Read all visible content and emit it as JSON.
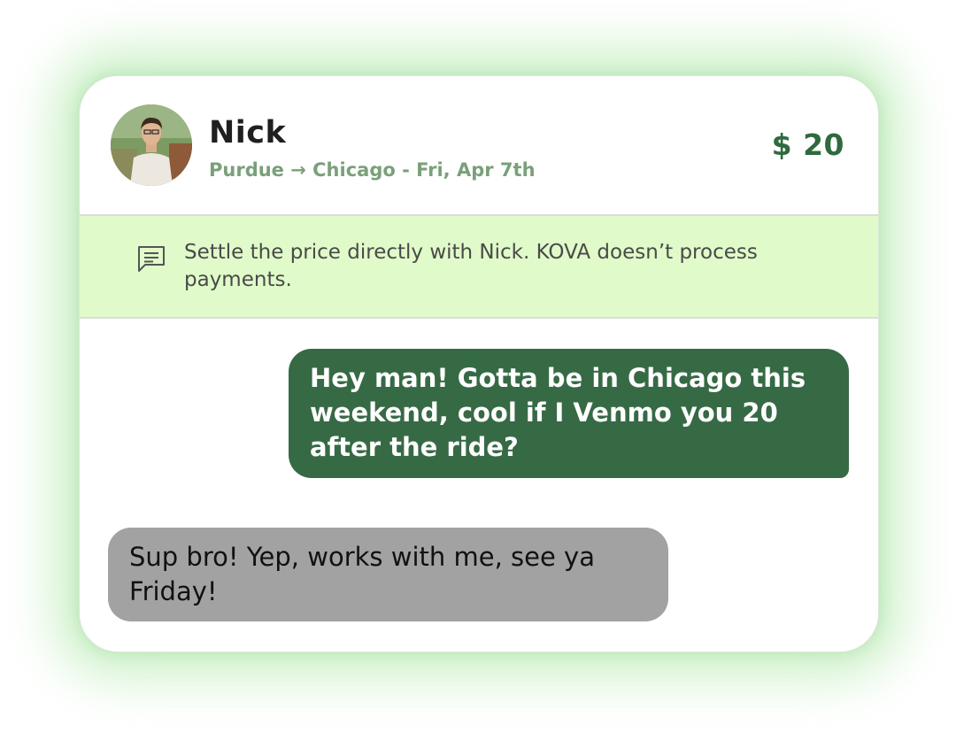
{
  "header": {
    "driver_name": "Nick",
    "route": "Purdue → Chicago - Fri, Apr 7th",
    "price": "$ 20"
  },
  "notice": {
    "icon": "message-icon",
    "text": "Settle the price directly with Nick. KOVA doesn’t process payments."
  },
  "messages": [
    {
      "sender": "me",
      "text": "Hey man! Gotta be in Chicago this weekend, cool if I Venmo you 20 after the ride?"
    },
    {
      "sender": "other",
      "text": "Sup bro! Yep, works with me, see ya Friday!"
    }
  ],
  "colors": {
    "accent_green": "#366a45",
    "route_green": "#7aa07a",
    "notice_background": "#e0fbc9",
    "received_bubble": "#a2a2a2"
  }
}
